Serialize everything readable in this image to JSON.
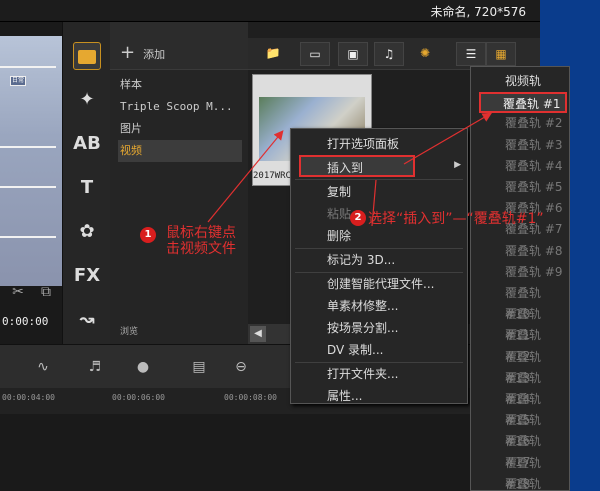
{
  "titlebar": {
    "project": "未命名, 720*576"
  },
  "preview": {
    "timecode": "0:00:00",
    "badge_text": "日常"
  },
  "library": {
    "add_label": "添加",
    "browse_label": "浏览",
    "items": [
      {
        "label": "样本"
      },
      {
        "label": "Triple Scoop M..."
      },
      {
        "label": "图片"
      },
      {
        "label": "视频"
      }
    ]
  },
  "thumbnail": {
    "caption": "2017WRC"
  },
  "timeline": {
    "ticks": [
      "00:00:04:00",
      "00:00:06:00",
      "00:00:08:00"
    ]
  },
  "context_menu": {
    "items": [
      {
        "label": "打开选项面板"
      },
      {
        "label": "插入到"
      },
      {
        "label": "复制"
      },
      {
        "label": "粘贴"
      },
      {
        "label": "删除"
      },
      {
        "label": "标记为 3D..."
      },
      {
        "label": "创建智能代理文件..."
      },
      {
        "label": "单素材修整..."
      },
      {
        "label": "按场景分割..."
      },
      {
        "label": "DV 录制..."
      },
      {
        "label": "打开文件夹..."
      },
      {
        "label": "属性..."
      }
    ]
  },
  "submenu": {
    "items": [
      "视频轨",
      "覆叠轨 #1",
      "覆叠轨 #2",
      "覆叠轨 #3",
      "覆叠轨 #4",
      "覆叠轨 #5",
      "覆叠轨 #6",
      "覆叠轨 #7",
      "覆叠轨 #8",
      "覆叠轨 #9",
      "覆叠轨 #10",
      "覆叠轨 #11",
      "覆叠轨 #12",
      "覆叠轨 #13",
      "覆叠轨 #14",
      "覆叠轨 #15",
      "覆叠轨 #16",
      "覆叠轨 #17",
      "覆叠轨 #18",
      "覆叠轨 #19"
    ]
  },
  "annotations": {
    "step1_num": "1",
    "step1_text_line1": "鼠标右键点",
    "step1_text_line2": "击视频文件",
    "step2_num": "2",
    "step2_text": "选择“插入到”—“覆叠轨#1”",
    "color": "#e03030"
  }
}
